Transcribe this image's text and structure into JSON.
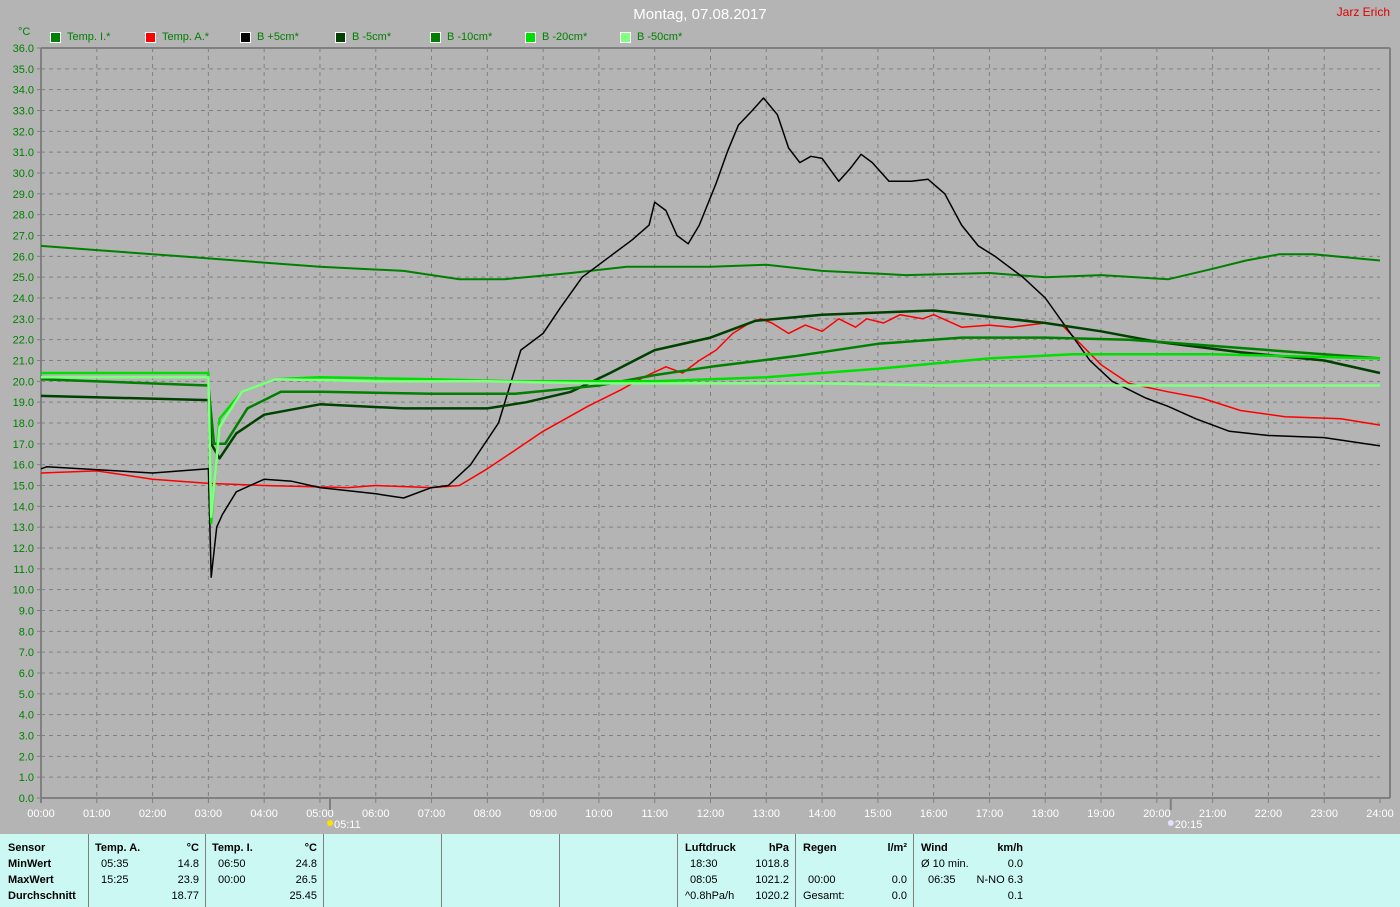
{
  "header": {
    "title": "Montag, 07.08.2017",
    "author": "Jarz Erich",
    "unit": "°C"
  },
  "chart_data": {
    "type": "line",
    "title": "Montag, 07.08.2017",
    "ylabel": "°C",
    "xlabel": "",
    "ylim": [
      0,
      36
    ],
    "xlim": [
      0,
      24
    ],
    "grid": true,
    "legend_position": "top",
    "yticks": [
      "0.0",
      "1.0",
      "2.0",
      "3.0",
      "4.0",
      "5.0",
      "6.0",
      "7.0",
      "8.0",
      "9.0",
      "10.0",
      "11.0",
      "12.0",
      "13.0",
      "14.0",
      "15.0",
      "16.0",
      "17.0",
      "18.0",
      "19.0",
      "20.0",
      "21.0",
      "22.0",
      "23.0",
      "24.0",
      "25.0",
      "26.0",
      "27.0",
      "28.0",
      "29.0",
      "30.0",
      "31.0",
      "32.0",
      "33.0",
      "34.0",
      "35.0",
      "36.0"
    ],
    "xticks": [
      "00:00",
      "01:00",
      "02:00",
      "03:00",
      "04:00",
      "05:00",
      "06:00",
      "07:00",
      "08:00",
      "09:00",
      "10:00",
      "11:00",
      "12:00",
      "13:00",
      "14:00",
      "15:00",
      "16:00",
      "17:00",
      "18:00",
      "19:00",
      "20:00",
      "21:00",
      "22:00",
      "23:00",
      "24:00"
    ],
    "markers": [
      {
        "label": "05:11",
        "x": 5.18,
        "type": "sunrise"
      },
      {
        "label": "20:15",
        "x": 20.25,
        "type": "sunset"
      }
    ],
    "series": [
      {
        "name": "Temp. I.*",
        "color": "#008000",
        "width": 2,
        "points": [
          [
            0,
            26.5
          ],
          [
            1,
            26.3
          ],
          [
            2.5,
            26.0
          ],
          [
            3.5,
            25.8
          ],
          [
            5,
            25.5
          ],
          [
            6.5,
            25.3
          ],
          [
            7.5,
            24.9
          ],
          [
            8.3,
            24.9
          ],
          [
            9.5,
            25.2
          ],
          [
            10.5,
            25.5
          ],
          [
            12,
            25.5
          ],
          [
            13,
            25.6
          ],
          [
            14,
            25.3
          ],
          [
            15.5,
            25.1
          ],
          [
            17,
            25.2
          ],
          [
            18,
            25.0
          ],
          [
            19,
            25.1
          ],
          [
            20.2,
            24.9
          ],
          [
            21,
            25.4
          ],
          [
            21.6,
            25.8
          ],
          [
            22.2,
            26.1
          ],
          [
            22.8,
            26.1
          ],
          [
            24,
            25.8
          ]
        ]
      },
      {
        "name": "Temp. A.*",
        "color": "#ff0000",
        "width": 1.5,
        "points": [
          [
            0,
            15.6
          ],
          [
            1,
            15.7
          ],
          [
            2,
            15.3
          ],
          [
            3,
            15.1
          ],
          [
            4,
            15.0
          ],
          [
            5.5,
            14.9
          ],
          [
            6,
            15.0
          ],
          [
            7,
            14.9
          ],
          [
            7.5,
            15.0
          ],
          [
            8,
            15.8
          ],
          [
            8.5,
            16.7
          ],
          [
            9,
            17.6
          ],
          [
            9.8,
            18.8
          ],
          [
            10.4,
            19.6
          ],
          [
            10.8,
            20.2
          ],
          [
            11.2,
            20.7
          ],
          [
            11.5,
            20.4
          ],
          [
            11.8,
            21.0
          ],
          [
            12.1,
            21.5
          ],
          [
            12.4,
            22.3
          ],
          [
            12.7,
            22.8
          ],
          [
            12.9,
            23.0
          ],
          [
            13.1,
            22.8
          ],
          [
            13.4,
            22.3
          ],
          [
            13.7,
            22.7
          ],
          [
            14.0,
            22.4
          ],
          [
            14.3,
            23.0
          ],
          [
            14.6,
            22.6
          ],
          [
            14.8,
            23.0
          ],
          [
            15.1,
            22.8
          ],
          [
            15.4,
            23.2
          ],
          [
            15.8,
            23.0
          ],
          [
            16.0,
            23.2
          ],
          [
            16.5,
            22.6
          ],
          [
            17,
            22.7
          ],
          [
            17.4,
            22.6
          ],
          [
            18,
            22.8
          ],
          [
            18.3,
            22.7
          ],
          [
            19,
            20.8
          ],
          [
            19.5,
            19.9
          ],
          [
            20.2,
            19.5
          ],
          [
            20.8,
            19.2
          ],
          [
            21.5,
            18.6
          ],
          [
            22.3,
            18.3
          ],
          [
            23.3,
            18.2
          ],
          [
            24,
            17.9
          ]
        ]
      },
      {
        "name": "B +5cm*",
        "color": "#000000",
        "width": 1.5,
        "points": [
          [
            0,
            15.8
          ],
          [
            0.1,
            15.9
          ],
          [
            2,
            15.6
          ],
          [
            3,
            15.8
          ],
          [
            3.05,
            10.6
          ],
          [
            3.15,
            13.0
          ],
          [
            3.25,
            13.6
          ],
          [
            3.5,
            14.7
          ],
          [
            4,
            15.3
          ],
          [
            4.5,
            15.2
          ],
          [
            5,
            14.9
          ],
          [
            6,
            14.6
          ],
          [
            6.5,
            14.4
          ],
          [
            7,
            14.9
          ],
          [
            7.3,
            15.0
          ],
          [
            7.7,
            16.0
          ],
          [
            8.2,
            18.0
          ],
          [
            8.6,
            21.5
          ],
          [
            9,
            22.3
          ],
          [
            9.3,
            23.5
          ],
          [
            9.7,
            25.0
          ],
          [
            10.2,
            26.0
          ],
          [
            10.6,
            26.8
          ],
          [
            10.9,
            27.5
          ],
          [
            11.0,
            28.6
          ],
          [
            11.2,
            28.2
          ],
          [
            11.4,
            27.0
          ],
          [
            11.6,
            26.6
          ],
          [
            11.8,
            27.5
          ],
          [
            12.1,
            29.5
          ],
          [
            12.3,
            31.0
          ],
          [
            12.5,
            32.3
          ],
          [
            12.75,
            33.0
          ],
          [
            12.95,
            33.6
          ],
          [
            13.2,
            32.8
          ],
          [
            13.4,
            31.2
          ],
          [
            13.6,
            30.5
          ],
          [
            13.8,
            30.8
          ],
          [
            14.0,
            30.7
          ],
          [
            14.3,
            29.6
          ],
          [
            14.5,
            30.2
          ],
          [
            14.7,
            30.9
          ],
          [
            14.9,
            30.5
          ],
          [
            15.2,
            29.6
          ],
          [
            15.6,
            29.6
          ],
          [
            15.9,
            29.7
          ],
          [
            16.2,
            29.0
          ],
          [
            16.5,
            27.5
          ],
          [
            16.8,
            26.5
          ],
          [
            17.1,
            26.0
          ],
          [
            17.6,
            25.0
          ],
          [
            18.0,
            24.0
          ],
          [
            18.4,
            22.5
          ],
          [
            18.8,
            21.0
          ],
          [
            19.2,
            20.0
          ],
          [
            19.8,
            19.2
          ],
          [
            20.2,
            18.8
          ],
          [
            20.7,
            18.2
          ],
          [
            21.3,
            17.6
          ],
          [
            22,
            17.4
          ],
          [
            23,
            17.3
          ],
          [
            24,
            16.9
          ]
        ]
      },
      {
        "name": "B -5cm*",
        "color": "#004000",
        "width": 2.5,
        "points": [
          [
            0,
            19.3
          ],
          [
            3,
            19.1
          ],
          [
            3.05,
            17.0
          ],
          [
            3.2,
            16.3
          ],
          [
            3.5,
            17.5
          ],
          [
            4,
            18.4
          ],
          [
            5,
            18.9
          ],
          [
            6.5,
            18.7
          ],
          [
            8,
            18.7
          ],
          [
            8.7,
            19.0
          ],
          [
            9.5,
            19.5
          ],
          [
            10.2,
            20.4
          ],
          [
            11,
            21.5
          ],
          [
            12,
            22.1
          ],
          [
            12.8,
            22.9
          ],
          [
            14,
            23.2
          ],
          [
            16,
            23.4
          ],
          [
            17,
            23.1
          ],
          [
            18,
            22.8
          ],
          [
            19,
            22.4
          ],
          [
            20,
            21.9
          ],
          [
            21.5,
            21.4
          ],
          [
            23,
            21.0
          ],
          [
            24,
            20.4
          ]
        ]
      },
      {
        "name": "B -10cm*",
        "color": "#008000",
        "width": 2.5,
        "points": [
          [
            0,
            20.1
          ],
          [
            3,
            19.8
          ],
          [
            3.1,
            17.0
          ],
          [
            3.3,
            17.0
          ],
          [
            3.7,
            18.7
          ],
          [
            4.3,
            19.5
          ],
          [
            5,
            19.5
          ],
          [
            7,
            19.4
          ],
          [
            8.5,
            19.4
          ],
          [
            10,
            19.8
          ],
          [
            11,
            20.3
          ],
          [
            12,
            20.7
          ],
          [
            13.5,
            21.2
          ],
          [
            15,
            21.8
          ],
          [
            16.5,
            22.1
          ],
          [
            18,
            22.1
          ],
          [
            19.5,
            22.0
          ],
          [
            21,
            21.7
          ],
          [
            22.5,
            21.4
          ],
          [
            24,
            21.1
          ]
        ]
      },
      {
        "name": "B -20cm*",
        "color": "#00e000",
        "width": 2.5,
        "points": [
          [
            0,
            20.4
          ],
          [
            3,
            20.4
          ],
          [
            3.05,
            13.2
          ],
          [
            3.2,
            18.2
          ],
          [
            3.6,
            19.5
          ],
          [
            4.2,
            20.1
          ],
          [
            5,
            20.2
          ],
          [
            7,
            20.1
          ],
          [
            8.5,
            20.0
          ],
          [
            11,
            20.0
          ],
          [
            13,
            20.2
          ],
          [
            15,
            20.6
          ],
          [
            17,
            21.1
          ],
          [
            18.5,
            21.3
          ],
          [
            21,
            21.3
          ],
          [
            24,
            21.1
          ]
        ]
      },
      {
        "name": "B -50cm*",
        "color": "#80ff80",
        "width": 2.5,
        "points": [
          [
            0,
            20.2
          ],
          [
            3,
            20.2
          ],
          [
            3.05,
            13.5
          ],
          [
            3.2,
            17.8
          ],
          [
            3.6,
            19.5
          ],
          [
            4.2,
            20.1
          ],
          [
            6,
            20.0
          ],
          [
            8,
            20.0
          ],
          [
            10,
            19.9
          ],
          [
            14,
            19.9
          ],
          [
            16,
            19.8
          ],
          [
            24,
            19.8
          ]
        ]
      }
    ]
  },
  "table": {
    "sensor": {
      "header": "Sensor",
      "rows": [
        "MinWert",
        "MaxWert",
        "Durchschnitt"
      ]
    },
    "temp_a": {
      "header": "Temp. A.",
      "unit": "°C",
      "min_time": "05:35",
      "min": "14.8",
      "max_time": "15:25",
      "max": "23.9",
      "avg": "18.77"
    },
    "temp_i": {
      "header": "Temp. I.",
      "unit": "°C",
      "min_time": "06:50",
      "min": "24.8",
      "max_time": "00:00",
      "max": "26.5",
      "avg": "25.45"
    },
    "luftdruck": {
      "header": "Luftdruck",
      "unit": "hPa",
      "r1_time": "18:30",
      "r1": "1018.8",
      "r2_time": "08:05",
      "r2": "1021.2",
      "r3_label": "^0.8hPa/h",
      "r3": "1020.2"
    },
    "regen": {
      "header": "Regen",
      "unit": "l/m²",
      "r2_time": "00:00",
      "r2": "0.0",
      "r3_label": "Gesamt:",
      "r3": "0.0"
    },
    "wind": {
      "header": "Wind",
      "unit": "km/h",
      "r1_label": "Ø 10 min.",
      "r1": "0.0",
      "r2_time": "06:35",
      "r2": "N-NO 6.3",
      "r3": "0.1"
    }
  }
}
